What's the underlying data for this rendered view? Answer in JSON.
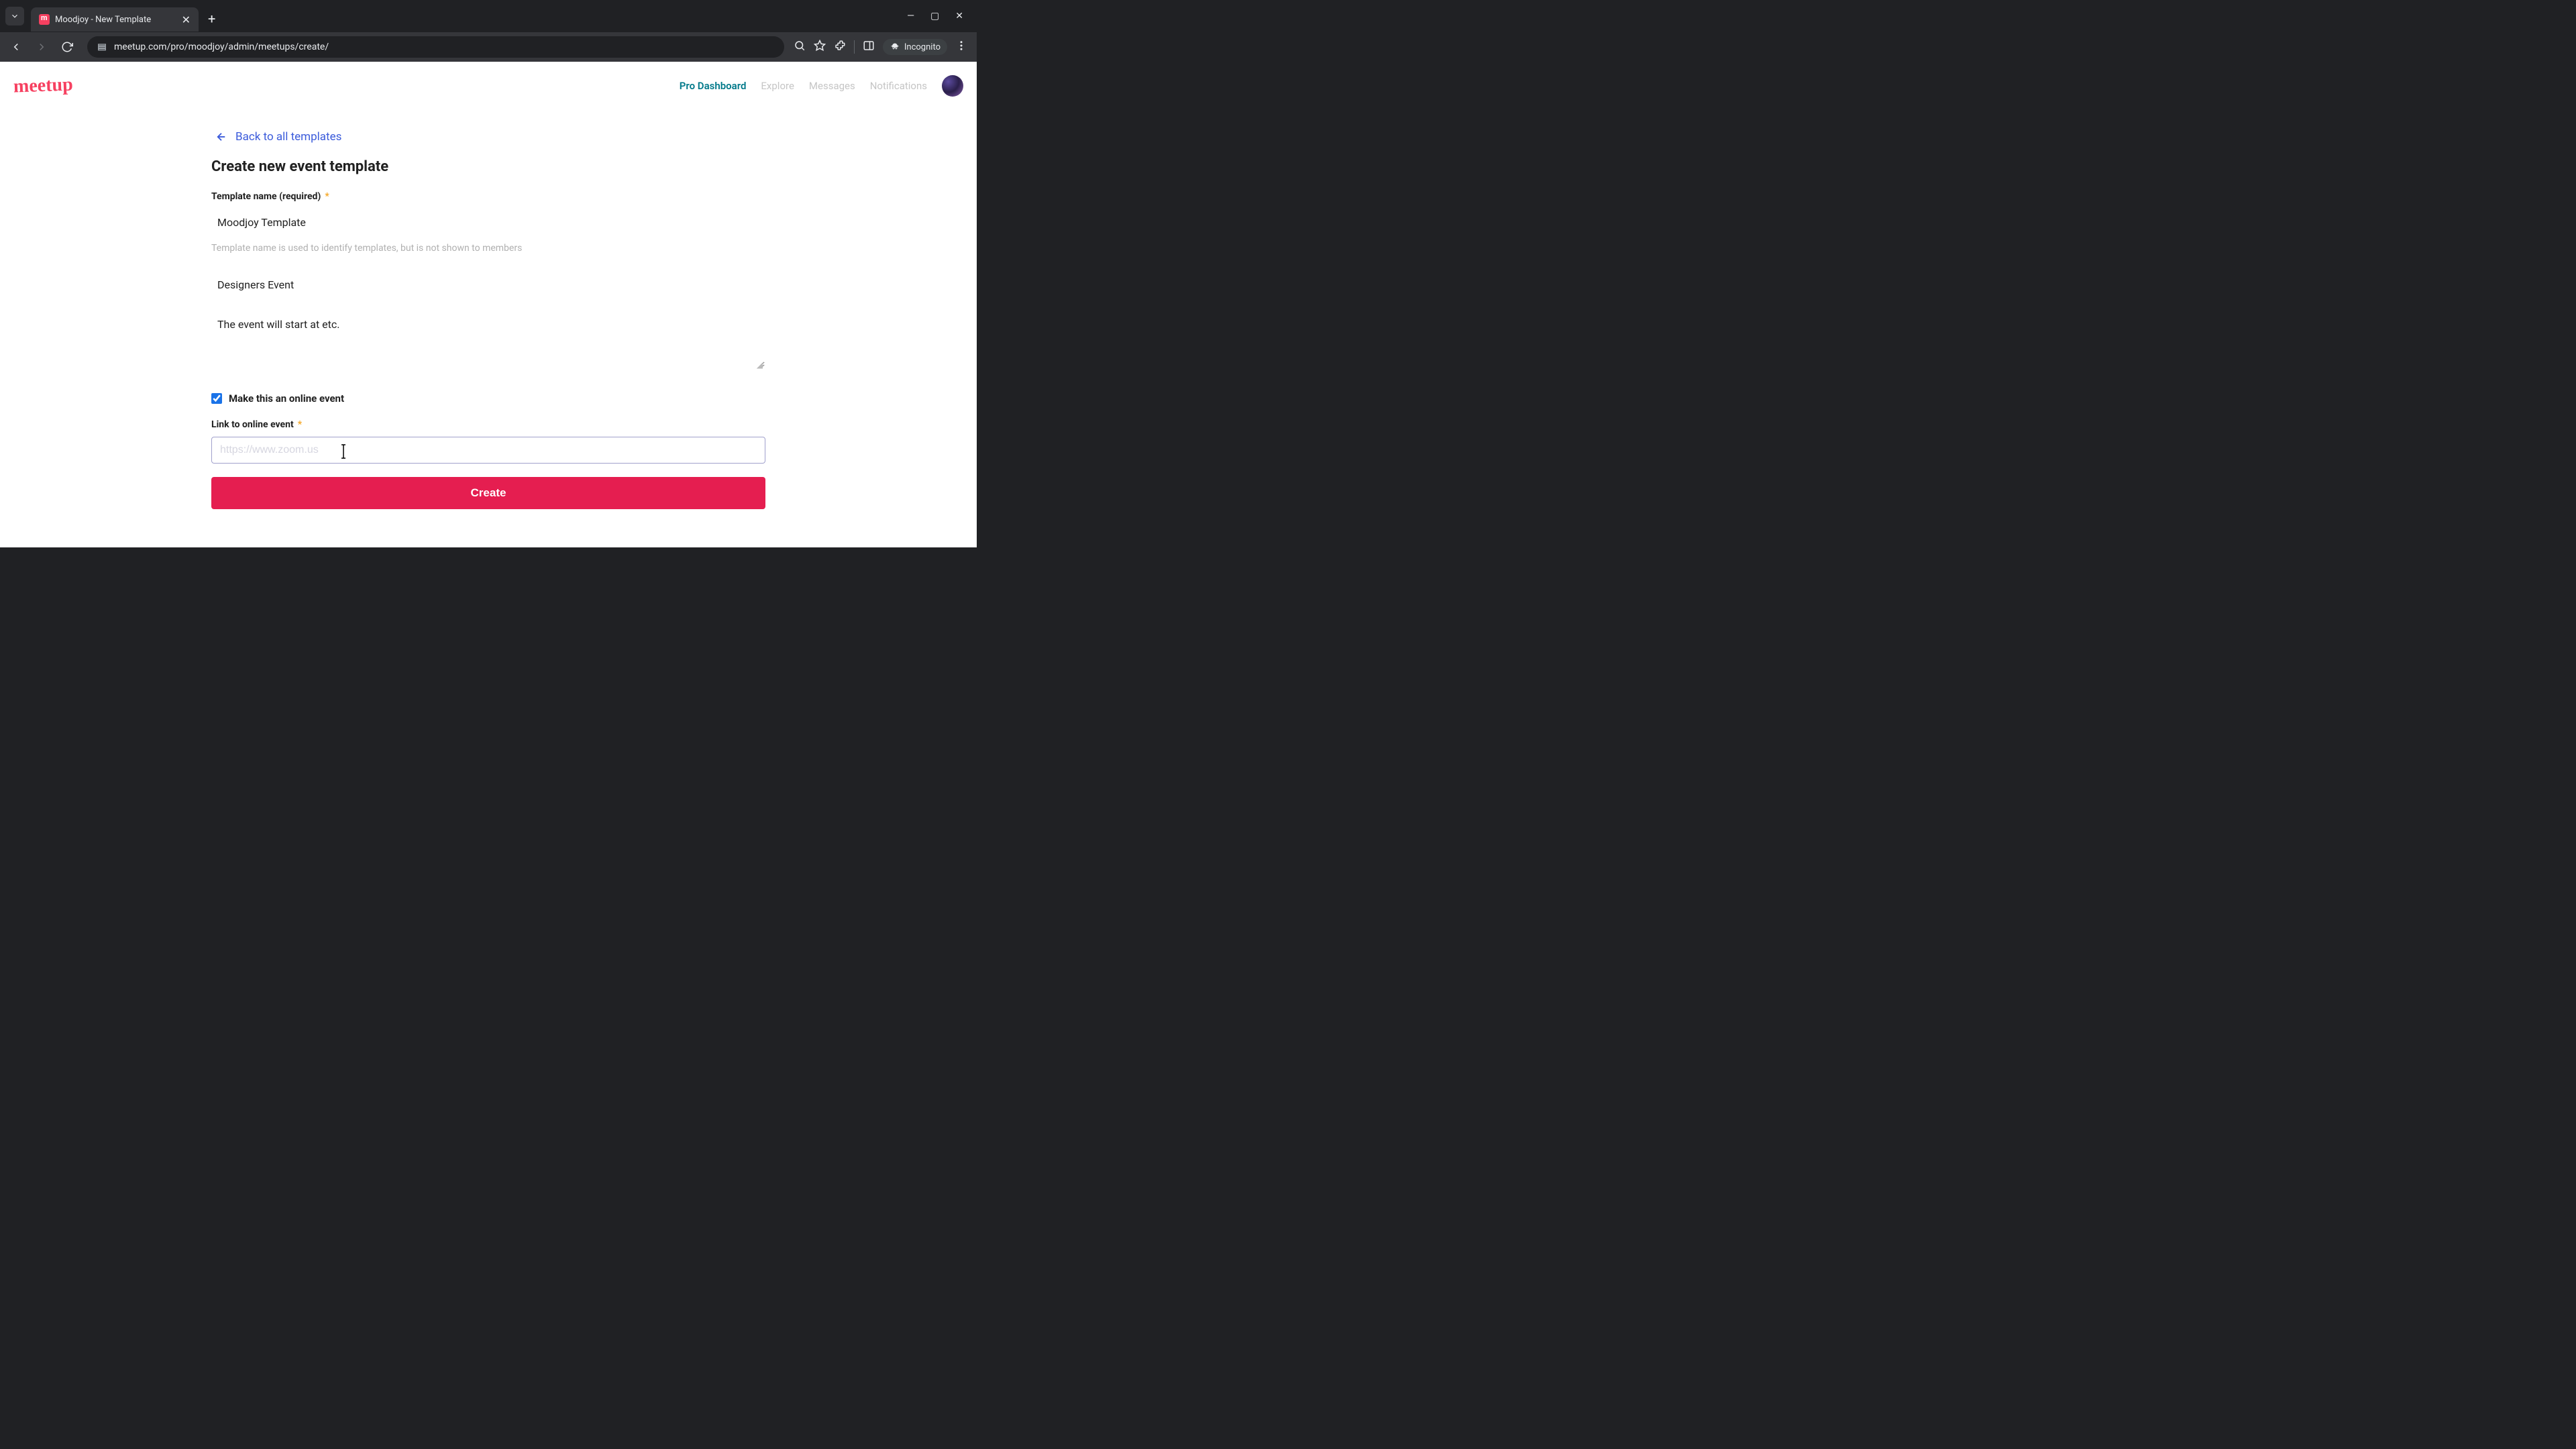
{
  "browser": {
    "tab_title": "Moodjoy - New Template",
    "url": "meetup.com/pro/moodjoy/admin/meetups/create/",
    "incognito_label": "Incognito"
  },
  "header": {
    "logo_text": "meetup",
    "nav": {
      "pro": "Pro Dashboard",
      "explore": "Explore",
      "messages": "Messages",
      "notifications": "Notifications"
    }
  },
  "page": {
    "back_link": "Back to all templates",
    "title": "Create new event template",
    "template_name": {
      "label": "Template name (required)",
      "value": "Moodjoy Template",
      "help": "Template name is used to identify templates, but is not shown to members"
    },
    "event_title": {
      "value": "Designers Event"
    },
    "description": {
      "value": "The event will start at etc."
    },
    "online_checkbox": {
      "label": "Make this an online event",
      "checked": true
    },
    "link": {
      "label": "Link to online event",
      "placeholder": "https://www.zoom.us",
      "value": ""
    },
    "create_button": "Create"
  }
}
